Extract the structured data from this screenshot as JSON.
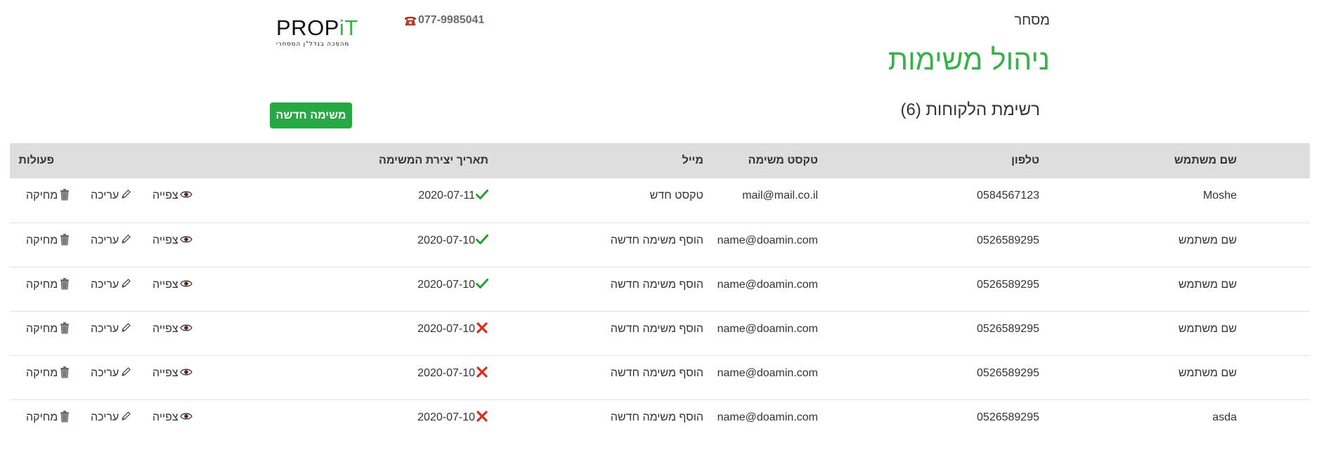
{
  "header": {
    "logo": {
      "word_dark": "PROP",
      "word_green": "iT",
      "tagline": "מהפכה בנדל\"ן המסחרי"
    },
    "phone": "077-9985041",
    "nav_trade": "מסחר",
    "title": "ניהול משימות"
  },
  "toolbar": {
    "new_task_label": "משימה חדשה",
    "list_caption": "רשימת הלקוחות (6)"
  },
  "table": {
    "headers": {
      "user": "שם משתמש",
      "phone": "טלפון",
      "task_text": "טקסט משימה",
      "mail": "מייל",
      "created": "תאריך יצירת המשימה",
      "actions": "פעולות"
    },
    "action_labels": {
      "view": "צפייה",
      "edit": "עריכה",
      "delete": "מחיקה"
    },
    "rows": [
      {
        "user": "Moshe",
        "phone": "0584567123",
        "task_text": "mail@mail.co.il",
        "mail": "טקסט חדש",
        "created": "2020-07-11",
        "status": "done"
      },
      {
        "user": "שם משתמש",
        "phone": "0526589295",
        "task_text": "name@doamin.com",
        "mail": "הוסף משימה חדשה",
        "created": "2020-07-10",
        "status": "done"
      },
      {
        "user": "שם משתמש",
        "phone": "0526589295",
        "task_text": "name@doamin.com",
        "mail": "הוסף משימה חדשה",
        "created": "2020-07-10",
        "status": "done"
      },
      {
        "user": "שם משתמש",
        "phone": "0526589295",
        "task_text": "name@doamin.com",
        "mail": "הוסף משימה חדשה",
        "created": "2020-07-10",
        "status": "not-done"
      },
      {
        "user": "שם משתמש",
        "phone": "0526589295",
        "task_text": "name@doamin.com",
        "mail": "הוסף משימה חדשה",
        "created": "2020-07-10",
        "status": "not-done"
      },
      {
        "user": "asda",
        "phone": "0526589295",
        "task_text": "name@doamin.com",
        "mail": "הוסף משימה חדשה",
        "created": "2020-07-10",
        "status": "not-done"
      }
    ]
  },
  "colors": {
    "brand_green": "#3ab04a",
    "button_green": "#28a745",
    "header_gray": "#dedede",
    "done_check": "#2a9d2a",
    "not_done_x": "#d62d20"
  },
  "icons": {
    "phone": "telephone-icon",
    "view": "eye-icon",
    "edit": "pencil-icon",
    "delete": "trash-icon",
    "done": "check-icon",
    "not_done": "x-icon"
  }
}
